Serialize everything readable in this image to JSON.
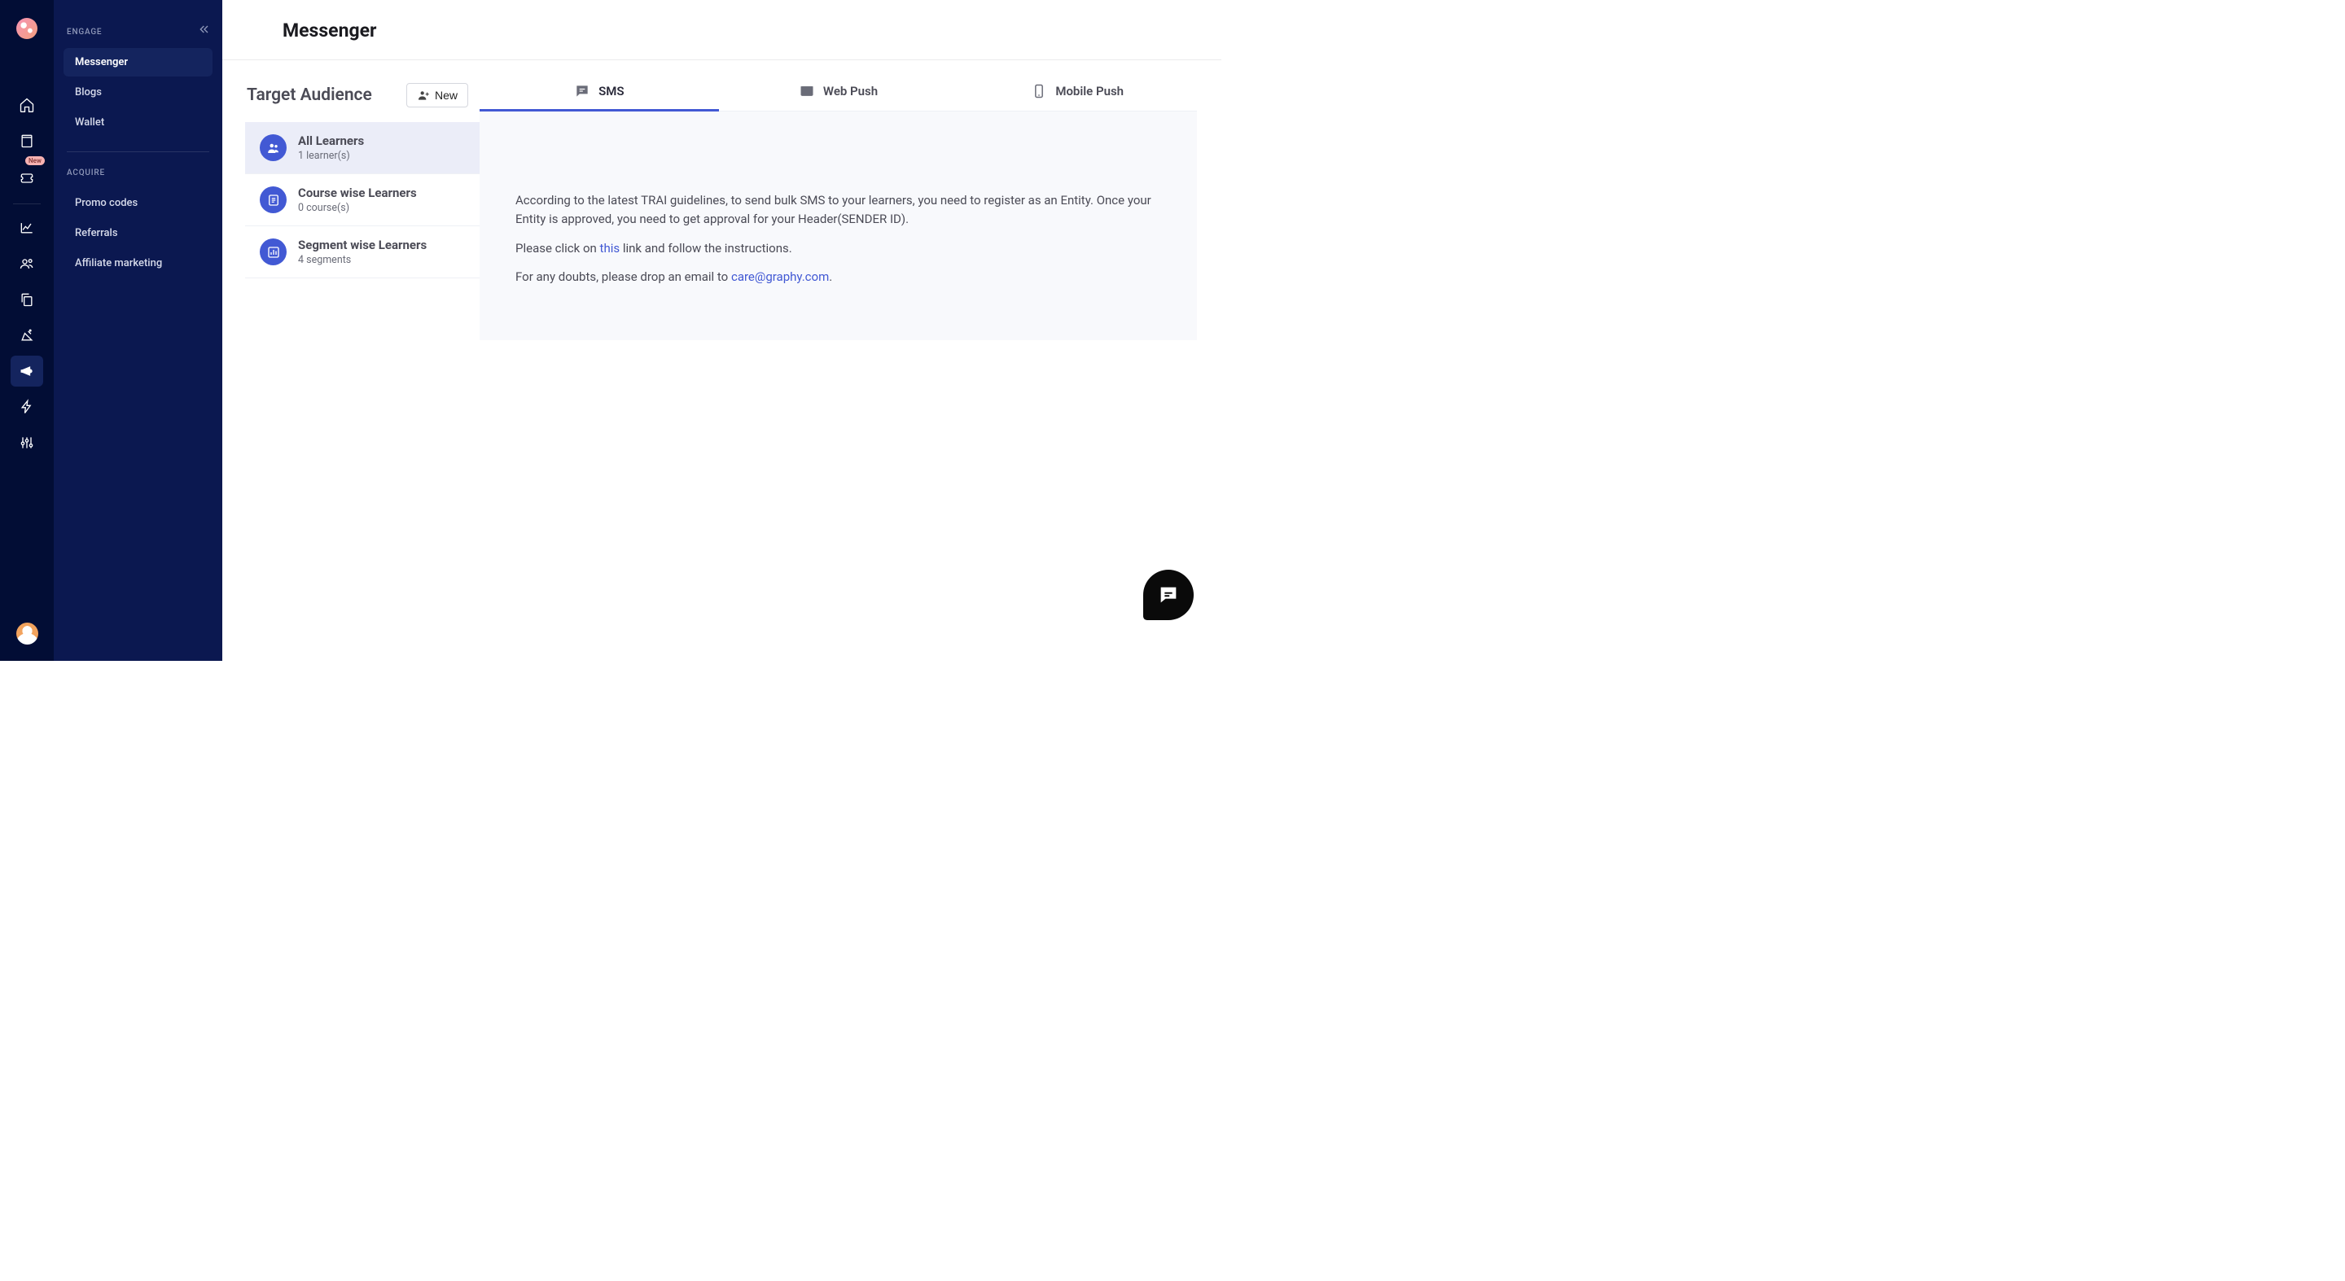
{
  "rail": {
    "badge_new": "New"
  },
  "subnav": {
    "section1": "ENGAGE",
    "items1": [
      "Messenger",
      "Blogs",
      "Wallet"
    ],
    "section2": "ACQUIRE",
    "items2": [
      "Promo codes",
      "Referrals",
      "Affiliate marketing"
    ]
  },
  "header": {
    "title": "Messenger"
  },
  "audience": {
    "title": "Target Audience",
    "new_label": "New",
    "items": [
      {
        "title": "All Learners",
        "subtitle": "1 learner(s)"
      },
      {
        "title": "Course wise Learners",
        "subtitle": "0 course(s)"
      },
      {
        "title": "Segment wise Learners",
        "subtitle": "4 segments"
      }
    ]
  },
  "tabs": {
    "items": [
      "SMS",
      "Web Push",
      "Mobile Push"
    ]
  },
  "sms_body": {
    "p1": "According to the latest TRAI guidelines, to send bulk SMS to your learners, you need to register as an Entity. Once your Entity is approved, you need to get approval for your Header(SENDER ID).",
    "p2_pre": "Please click on ",
    "p2_link": "this",
    "p2_post": " link and follow the instructions.",
    "p3_pre": "For any doubts, please drop an email to ",
    "p3_link": "care@graphy.com",
    "p3_post": "."
  }
}
